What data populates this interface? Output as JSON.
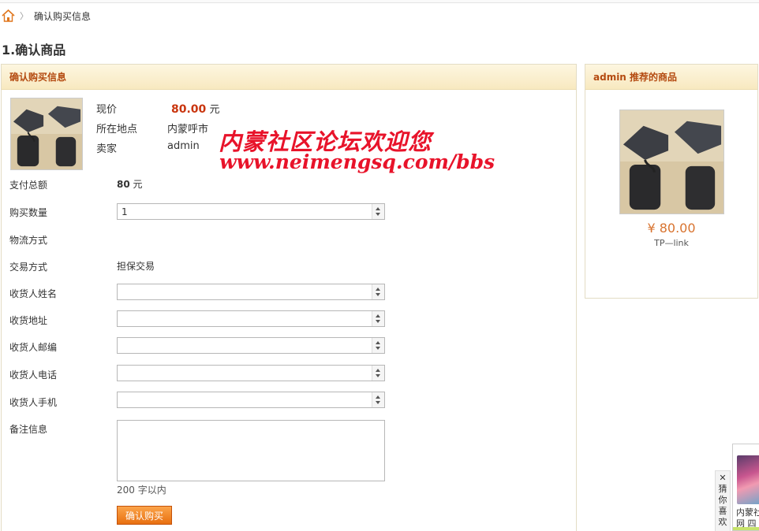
{
  "breadcrumb": {
    "current": "确认购买信息"
  },
  "page_title": "1.确认商品",
  "main_panel": {
    "title": "确认购买信息",
    "info": [
      {
        "label": "现价",
        "value": "80.00",
        "unit": "元"
      },
      {
        "label": "所在地点",
        "value": "内蒙呼市"
      },
      {
        "label": "卖家",
        "value": "admin"
      }
    ],
    "total": {
      "label": "支付总额",
      "value": "80",
      "unit": "元"
    },
    "quantity": {
      "label": "购买数量",
      "value": "1"
    },
    "logistics": {
      "label": "物流方式"
    },
    "trade": {
      "label": "交易方式",
      "value": "担保交易"
    },
    "receiver_name": {
      "label": "收货人姓名",
      "value": ""
    },
    "receiver_address": {
      "label": "收货地址",
      "value": ""
    },
    "receiver_zip": {
      "label": "收货人邮编",
      "value": ""
    },
    "receiver_phone": {
      "label": "收货人电话",
      "value": ""
    },
    "receiver_mobile": {
      "label": "收货人手机",
      "value": ""
    },
    "note": {
      "label": "备注信息",
      "limit": "200 字以内"
    },
    "submit_label": "确认购买"
  },
  "side_panel": {
    "title": "admin 推荐的商品",
    "price": "¥ 80.00",
    "name": "TP—link"
  },
  "watermark": {
    "line1": "内蒙社区论坛欢迎您",
    "line2": "www.neimengsq.com/bbs"
  },
  "float_ad": {
    "close": "✕",
    "vertical_text": [
      "猜",
      "你",
      "喜",
      "欢"
    ],
    "caption_1": "内蒙社",
    "caption_2": "网  四"
  },
  "colors": {
    "accent": "#b44a10",
    "price": "#c9350e",
    "button": "#e86f10",
    "watermark": "#e8132a"
  }
}
